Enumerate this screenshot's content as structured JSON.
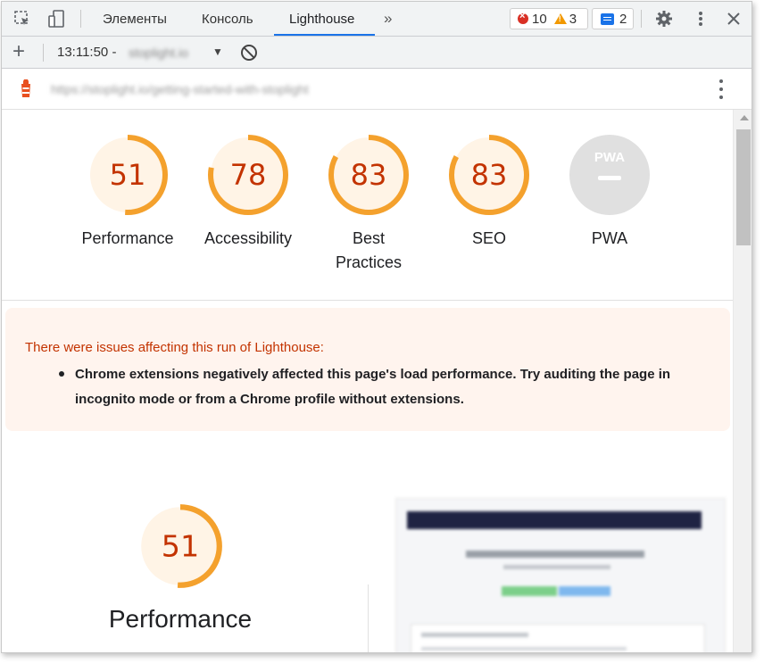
{
  "devtools": {
    "tabs": [
      {
        "label": "Элементы"
      },
      {
        "label": "Консоль"
      },
      {
        "label": "Lighthouse"
      }
    ],
    "more_tabs_glyph": "»",
    "errors_count": "10",
    "warnings_count": "3",
    "messages_count": "2",
    "icons": {
      "inspect": "inspect-element-icon",
      "device": "device-toggle-icon",
      "settings": "gear-icon",
      "more": "kebab-menu-icon",
      "close": "close-icon"
    }
  },
  "report_bar": {
    "time": "13:11:50 -",
    "site": "stoplight.io",
    "url": "https://stoplight.io/getting-started-with-stoplight"
  },
  "scores": [
    {
      "label": "Performance",
      "value": "51",
      "fraction": 0.51,
      "color": "#f4a12d",
      "text_color": "#c33300",
      "fill": "#fff4e6"
    },
    {
      "label": "Accessibility",
      "value": "78",
      "fraction": 0.78,
      "color": "#f4a12d",
      "text_color": "#c33300",
      "fill": "#fff4e6"
    },
    {
      "label": "Best Practices",
      "label_line1": "Best",
      "label_line2": "Practices",
      "value": "83",
      "fraction": 0.83,
      "color": "#f4a12d",
      "text_color": "#c33300",
      "fill": "#fff4e6"
    },
    {
      "label": "SEO",
      "value": "83",
      "fraction": 0.83,
      "color": "#f4a12d",
      "text_color": "#c33300",
      "fill": "#fff4e6"
    },
    {
      "label": "PWA",
      "badge": "PWA",
      "color": "#e0e0e0"
    }
  ],
  "warning": {
    "title": "There were issues affecting this run of Lighthouse:",
    "item": "Chrome extensions negatively affected this page's load performance. Try auditing the page in incognito mode or from a Chrome profile without extensions."
  },
  "main_score": {
    "value": "51",
    "fraction": 0.51,
    "label": "Performance"
  },
  "colors": {
    "accent": "#1a73e8",
    "gauge_orange": "#f4a12d",
    "score_text": "#c33300",
    "warning_bg": "#fff4ee"
  }
}
